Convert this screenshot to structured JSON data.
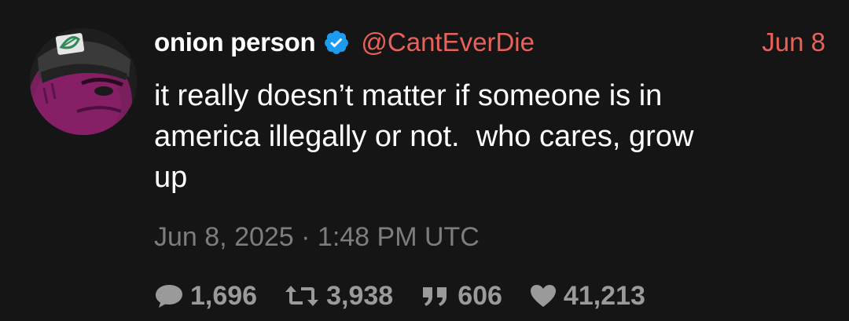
{
  "user": {
    "display_name": "onion person",
    "handle": "@CantEverDie",
    "verified": true
  },
  "post": {
    "date_short": "Jun 8",
    "text": "it really doesn’t matter if someone is in\namerica illegally or not.  who cares, grow\nup",
    "timestamp": "Jun 8, 2025 · 1:48 PM UTC"
  },
  "stats": {
    "comments": "1,696",
    "retweets": "3,938",
    "quotes": "606",
    "likes": "41,213"
  },
  "colors": {
    "background": "#151515",
    "accent": "#e8615a",
    "verified_badge": "#1d9bf0",
    "muted_text": "#7d7d7d",
    "stat_text": "#9a9a9a"
  },
  "icons": {
    "verified": "verified-badge-icon",
    "comments": "comment-bubble-icon",
    "retweets": "retweet-icon",
    "quotes": "quote-icon",
    "likes": "heart-icon"
  }
}
